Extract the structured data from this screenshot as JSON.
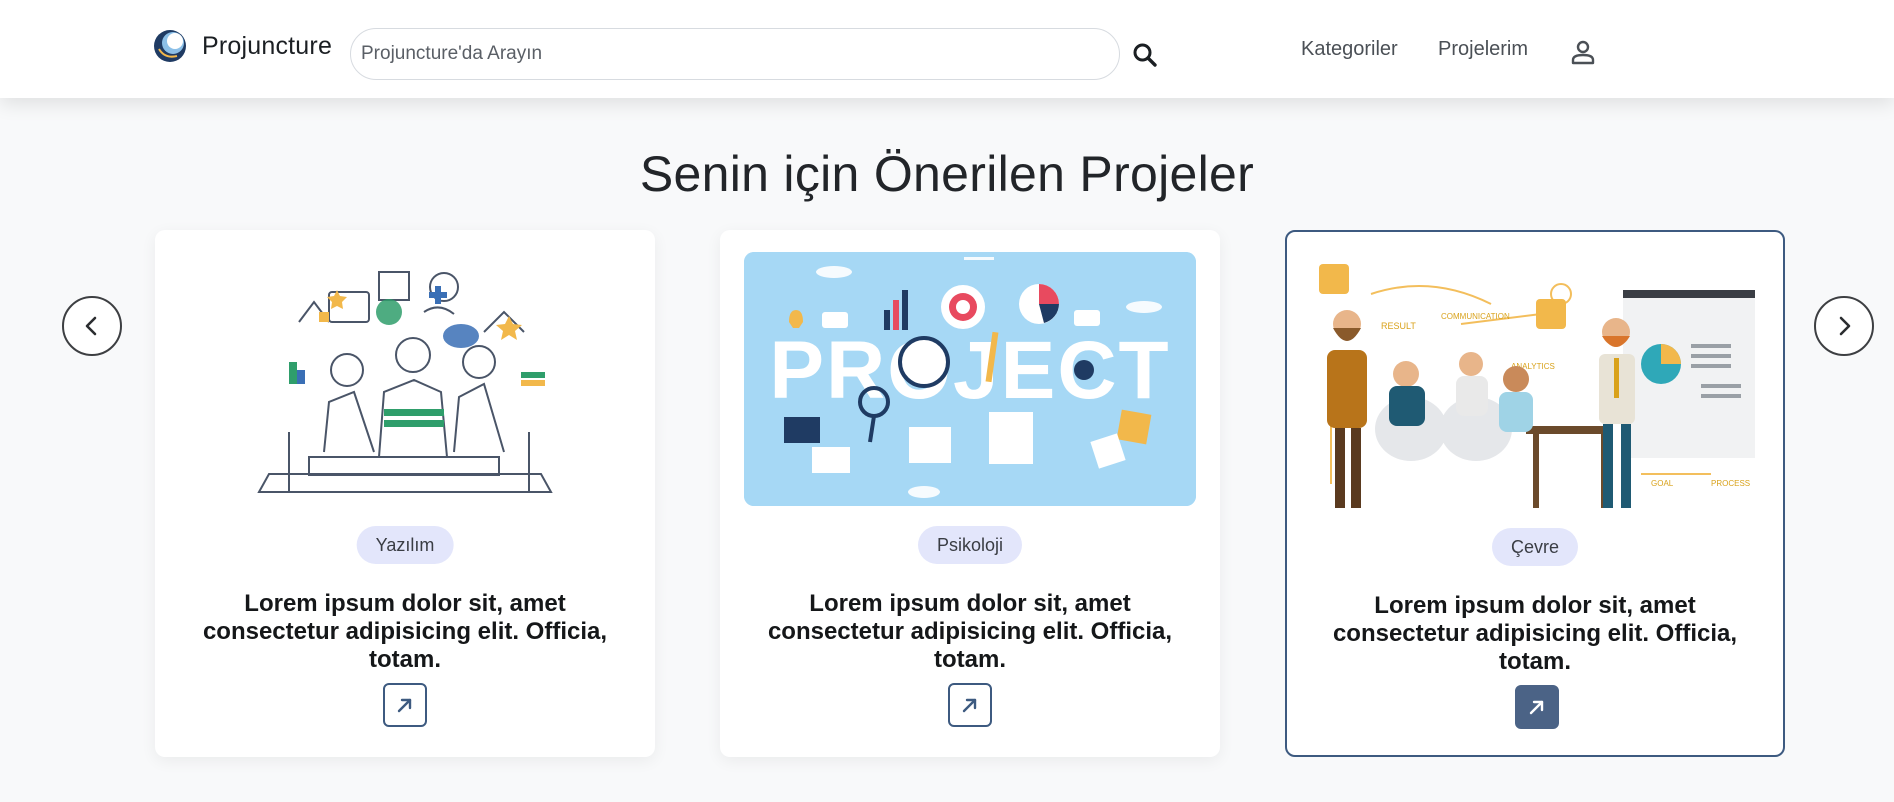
{
  "header": {
    "brand_name": "Projuncture",
    "search_placeholder": "Projuncture'da Arayın",
    "nav": {
      "categories": "Kategoriler",
      "my_projects": "Projelerim"
    }
  },
  "section": {
    "title": "Senin için Önerilen Projeler"
  },
  "cards": [
    {
      "category": "Yazılım",
      "text": "Lorem ipsum dolor sit, amet consectetur adipisicing elit. Officia, totam.",
      "image": "team-line-art-illustration"
    },
    {
      "category": "Psikoloji",
      "text": "Lorem ipsum dolor sit, amet consectetur adipisicing elit. Officia, totam.",
      "image": "project-banner-illustration",
      "image_text": "PROJECT"
    },
    {
      "category": "Çevre",
      "text": "Lorem ipsum dolor sit, amet consectetur adipisicing elit. Officia, totam.",
      "image": "business-meeting-illustration",
      "image_labels": [
        "RESULT",
        "COMMUNICATION",
        "ANALYTICS",
        "GOAL",
        "PROCESS"
      ]
    }
  ],
  "colors": {
    "accent": "#3d5a80",
    "badge_bg": "#e3e6fb",
    "project_banner_bg": "#a6d8f5",
    "filled_button": "#4b6386"
  }
}
